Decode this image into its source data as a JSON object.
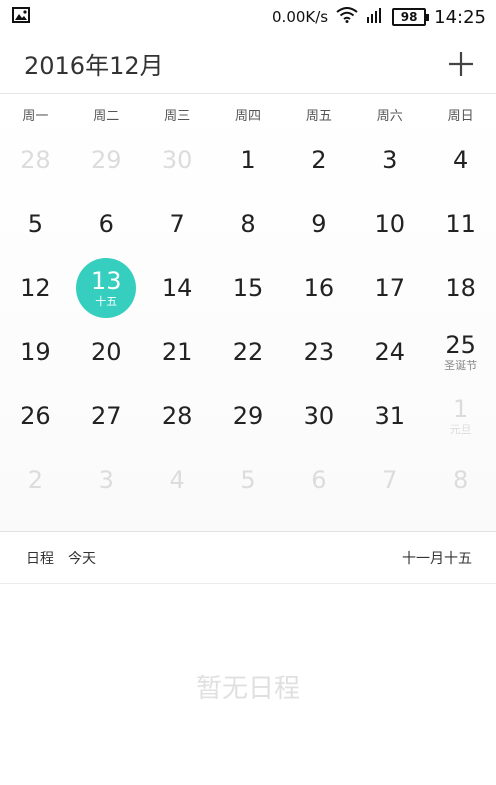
{
  "status": {
    "speed": "0.00K/s",
    "battery": "98",
    "time": "14:25"
  },
  "header": {
    "title": "2016年12月"
  },
  "weekdays": [
    "周一",
    "周二",
    "周三",
    "周四",
    "周五",
    "周六",
    "周日"
  ],
  "calendar": {
    "weeks": [
      [
        {
          "d": "28",
          "outside": true
        },
        {
          "d": "29",
          "outside": true
        },
        {
          "d": "30",
          "outside": true
        },
        {
          "d": "1"
        },
        {
          "d": "2"
        },
        {
          "d": "3"
        },
        {
          "d": "4"
        }
      ],
      [
        {
          "d": "5"
        },
        {
          "d": "6"
        },
        {
          "d": "7"
        },
        {
          "d": "8"
        },
        {
          "d": "9"
        },
        {
          "d": "10"
        },
        {
          "d": "11"
        }
      ],
      [
        {
          "d": "12"
        },
        {
          "d": "13",
          "sub": "十五",
          "selected": true
        },
        {
          "d": "14"
        },
        {
          "d": "15"
        },
        {
          "d": "16"
        },
        {
          "d": "17"
        },
        {
          "d": "18"
        }
      ],
      [
        {
          "d": "19"
        },
        {
          "d": "20"
        },
        {
          "d": "21"
        },
        {
          "d": "22"
        },
        {
          "d": "23"
        },
        {
          "d": "24"
        },
        {
          "d": "25",
          "sub": "圣诞节"
        }
      ],
      [
        {
          "d": "26"
        },
        {
          "d": "27"
        },
        {
          "d": "28"
        },
        {
          "d": "29"
        },
        {
          "d": "30"
        },
        {
          "d": "31"
        },
        {
          "d": "1",
          "sub": "元旦",
          "outside": true
        }
      ],
      [
        {
          "d": "2",
          "outside": true
        },
        {
          "d": "3",
          "outside": true
        },
        {
          "d": "4",
          "outside": true
        },
        {
          "d": "5",
          "outside": true
        },
        {
          "d": "6",
          "outside": true
        },
        {
          "d": "7",
          "outside": true
        },
        {
          "d": "8",
          "outside": true
        }
      ]
    ]
  },
  "schedule": {
    "label": "日程",
    "today": "今天",
    "lunar_date": "十一月十五",
    "empty_text": "暂无日程"
  },
  "colors": {
    "accent": "#36cfbf"
  }
}
